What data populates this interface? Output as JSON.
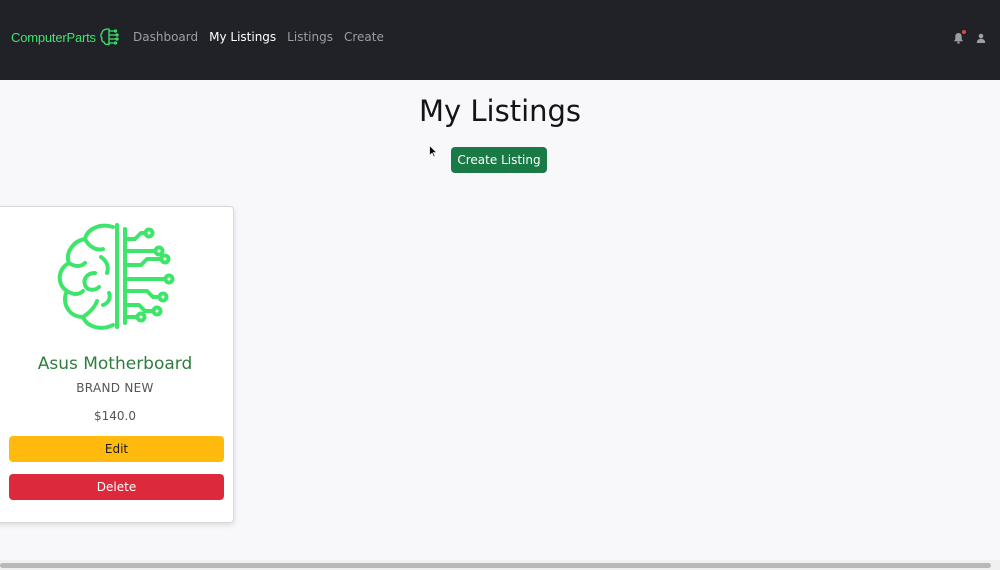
{
  "navbar": {
    "brand": "ComputerParts",
    "links": [
      {
        "label": "Dashboard",
        "active": false
      },
      {
        "label": "My Listings",
        "active": true
      },
      {
        "label": "Listings",
        "active": false
      },
      {
        "label": "Create",
        "active": false
      }
    ],
    "icons": [
      "bell-icon",
      "user-icon"
    ],
    "notification_dot_color": "#e04646"
  },
  "page": {
    "title": "My Listings",
    "create_button_label": "Create Listing"
  },
  "listings": [
    {
      "image_icon": "brain-circuit-icon",
      "title": "Asus Motherboard",
      "condition": "BRAND NEW",
      "price": "$140.0",
      "edit_label": "Edit",
      "delete_label": "Delete"
    }
  ],
  "colors": {
    "brand_green": "#3ee56b",
    "navbar_bg": "#202227",
    "create_button": "#1a7a45",
    "edit_button": "#ffba0d",
    "delete_button": "#dc2a3c",
    "card_title": "#2e7d3d"
  }
}
